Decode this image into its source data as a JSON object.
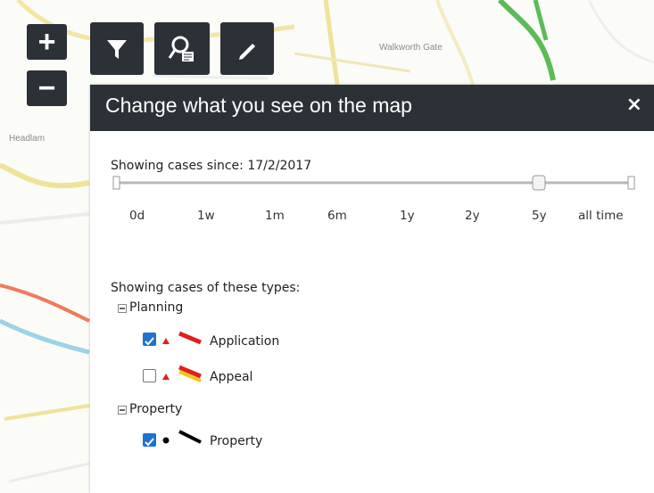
{
  "map": {
    "labels": [
      "Walkworth Gate",
      "Headlam"
    ]
  },
  "toolbar": {
    "zoom_in_label": "+",
    "zoom_out_label": "−",
    "filter_icon": "filter-icon",
    "search_icon": "search-map-icon",
    "draw_icon": "pencil-icon"
  },
  "panel": {
    "title": "Change what you see on the map",
    "close_label": "×",
    "time": {
      "label": "Showing cases since: 17/2/2017",
      "ticks": [
        "0d",
        "1w",
        "1m",
        "6m",
        "1y",
        "2y",
        "5y",
        "all time"
      ],
      "selected": "5y"
    },
    "types": {
      "label": "Showing cases of these types:",
      "groups": [
        {
          "name": "Planning",
          "items": [
            {
              "label": "Application",
              "checked": true,
              "point_color": "#e0201b",
              "line_colors": [
                "#e0201b"
              ]
            },
            {
              "label": "Appeal",
              "checked": false,
              "point_color": "#e0201b",
              "line_colors": [
                "#e0201b",
                "#f3c61a"
              ]
            }
          ]
        },
        {
          "name": "Property",
          "items": [
            {
              "label": "Property",
              "checked": true,
              "point_color": "#000000",
              "line_colors": [
                "#000000"
              ]
            }
          ]
        }
      ]
    }
  },
  "colors": {
    "panel_header": "#2b3137",
    "checkbox": "#1e73d0"
  }
}
